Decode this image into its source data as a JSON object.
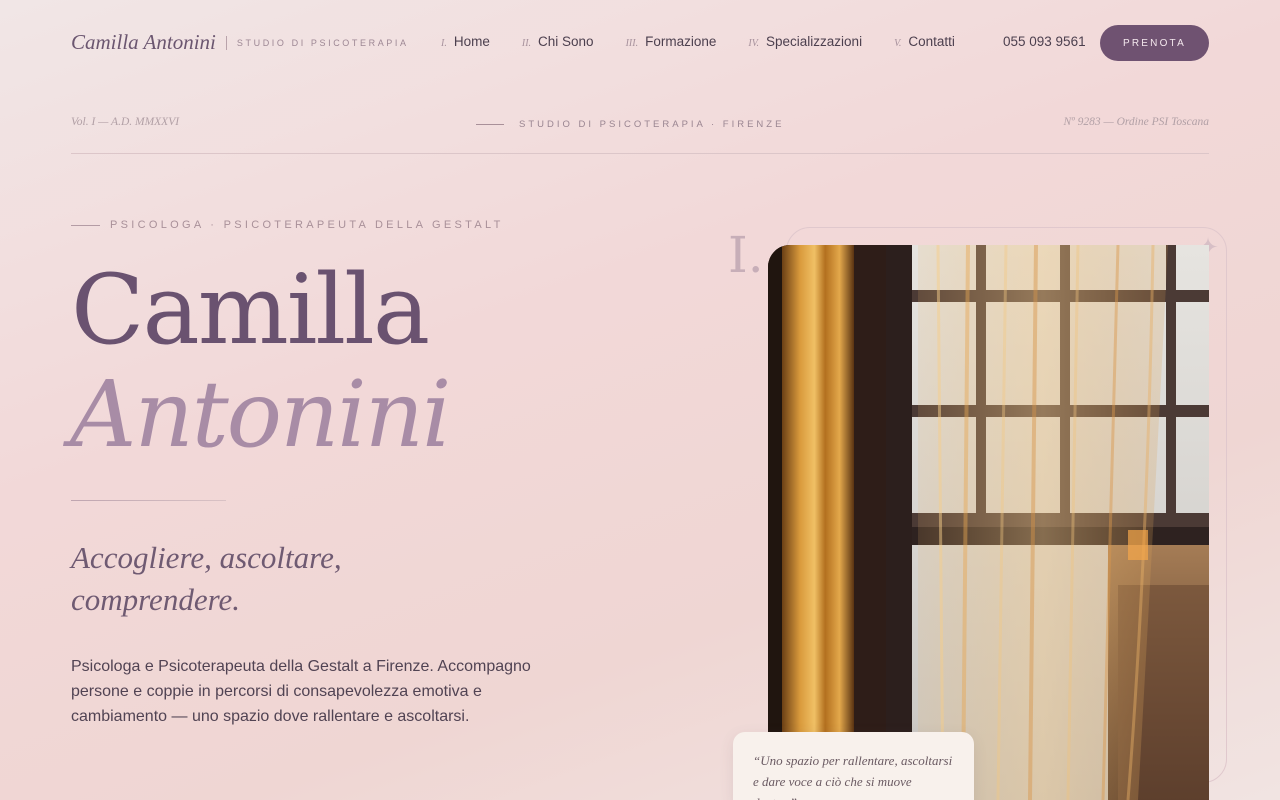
{
  "header": {
    "brand_name": "Camilla Antonini",
    "brand_tag": "Studio di Psicoterapia",
    "menu": [
      {
        "num": "I.",
        "label": "Home"
      },
      {
        "num": "II.",
        "label": "Chi Sono"
      },
      {
        "num": "III.",
        "label": "Formazione"
      },
      {
        "num": "IV.",
        "label": "Specializzazioni"
      },
      {
        "num": "V.",
        "label": "Contatti"
      }
    ],
    "phone": "055 093 9561",
    "cta_label": "Prenota"
  },
  "masthead": {
    "left": "Vol. I — A.D. MMXXVI",
    "center": "Studio di Psicoterapia · Firenze",
    "right": "Nº 9283 — Ordine PSI Toscana"
  },
  "hero": {
    "eyebrow": "Psicologa · Psicoterapeuta della Gestalt",
    "first_name": "Camilla",
    "last_name": "Antonini",
    "tagline_line1": "Accogliere, ascoltare,",
    "tagline_line2": "comprendere.",
    "intro": "Psicologa e Psicoterapeuta della Gestalt a Firenze. Accompagno persone e coppie in percorsi di consapevolezza emotiva e cambiamento — uno spazio dove rallentare e ascoltarsi."
  },
  "visual": {
    "roman_numeral": "I.",
    "photo_subject": "window-curtain-photo",
    "quote": "“Uno spazio per rallentare, ascoltarsi e dare voce a ciò che si muove dentro.”"
  },
  "colors": {
    "accent": "#6f5271",
    "heading": "#6a5270",
    "heading_light": "#a88ca6",
    "background": "#f2d8d8"
  }
}
